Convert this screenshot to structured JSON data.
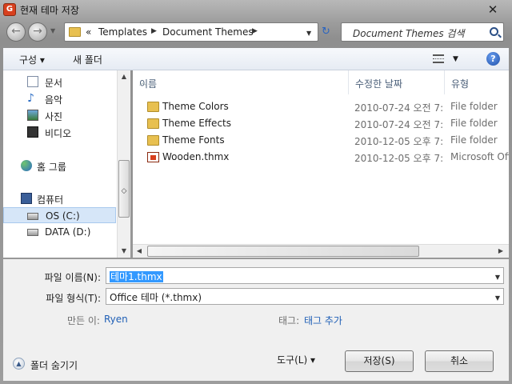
{
  "window": {
    "title": "현재 테마 저장",
    "icon_letter": "G",
    "close_glyph": "✕"
  },
  "nav": {
    "back_glyph": "←",
    "forward_glyph": "→",
    "breadcrumb_prefix": "«",
    "breadcrumbs": [
      "Templates",
      "Document Themes"
    ],
    "search_placeholder": "Document Themes 검색"
  },
  "toolbar": {
    "organize": "구성",
    "new_folder": "새 폴더",
    "help": "?"
  },
  "sidebar": {
    "libraries": [
      "문서",
      "음악",
      "사진",
      "비디오"
    ],
    "homegroup": "홈 그룹",
    "computer": "컴퓨터",
    "drives": [
      "OS (C:)",
      "DATA (D:)"
    ],
    "selected": "OS (C:)"
  },
  "filelist": {
    "columns": [
      "이름",
      "수정한 날짜",
      "유형"
    ],
    "rows": [
      {
        "name": "Theme Colors",
        "date": "2010-07-24 오전 7:...",
        "type": "File folder",
        "icon": "folder-icon"
      },
      {
        "name": "Theme Effects",
        "date": "2010-07-24 오전 7:...",
        "type": "File folder",
        "icon": "folder-icon"
      },
      {
        "name": "Theme Fonts",
        "date": "2010-12-05 오후 7:...",
        "type": "File folder",
        "icon": "folder-icon"
      },
      {
        "name": "Wooden.thmx",
        "date": "2010-12-05 오후 7:...",
        "type": "Microsoft Offi",
        "icon": "thmx-file-icon"
      }
    ]
  },
  "form": {
    "filename_label": "파일 이름(N):",
    "filename_value": "테마1.thmx",
    "filetype_label": "파일 형식(T):",
    "filetype_value": "Office 테마 (*.thmx)",
    "authors_label": "만든 이:",
    "authors_value": "Ryen",
    "tags_label": "태그:",
    "tags_value": "태그 추가"
  },
  "footer": {
    "hide_folders": "폴더 숨기기",
    "tools": "도구(L)",
    "save": "저장(S)",
    "cancel": "취소"
  }
}
